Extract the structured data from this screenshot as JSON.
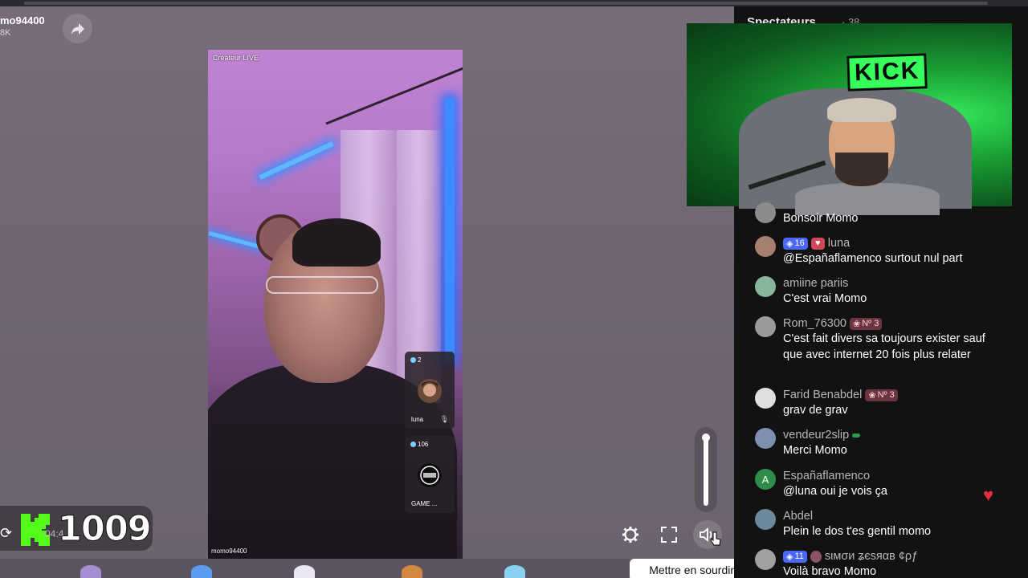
{
  "host": {
    "name": "mo94400",
    "count": "8K"
  },
  "video": {
    "creator_tag": "Créateur LIVE",
    "username": "momo94400"
  },
  "guests": [
    {
      "count": "2",
      "name": "luna"
    },
    {
      "count": "106",
      "name": "GAME ..."
    }
  ],
  "controls": {
    "tooltip": "Mettre en sourdine (M)",
    "volume_level": 1.0
  },
  "kick_overlay": {
    "number": "1009",
    "time": "04:4"
  },
  "panel": {
    "title": "Spectateurs",
    "count": "· 38"
  },
  "webcam": {
    "sign_text": "KICK"
  },
  "chat": [
    {
      "user": "",
      "text": "Bonsoir Momo",
      "avatar_color": "#8c8c8c"
    },
    {
      "user": "luna",
      "text": "@Españaflamenco surtout nul part",
      "badge_num": "16",
      "avatar_color": "#a58070"
    },
    {
      "user": "amiine pariis",
      "text": "C'est vrai Momo",
      "avatar_color": "#88b69a"
    },
    {
      "user": "Rom_76300",
      "text": "C'est fait divers sa toujours exister sauf que avec internet 20 fois plus relater",
      "rank": "Nº 3",
      "avatar_color": "#9a9a9a"
    },
    {
      "user": "Farid Benabdel",
      "text": "grav de grav",
      "rank": "Nº 3",
      "avatar_color": "#e0e0e0"
    },
    {
      "user": "vendeur2slip",
      "text": "Merci Momo",
      "avatar_color": "#7f8fb0"
    },
    {
      "user": "Españaflamenco",
      "text": "@luna oui je vois ça",
      "avatar_letter": "A",
      "avatar_color": "#2e8b4a"
    },
    {
      "user": "Abdel",
      "text": "Plein le dos t'es gentil momo",
      "avatar_color": "#6a8a9c"
    },
    {
      "user": "ѕιмσи ʑєѕяαв ¢ρƒ",
      "text": "Voilà bravo Momo",
      "badge_num": "11",
      "avatar_color": "#a0a0a0"
    }
  ]
}
